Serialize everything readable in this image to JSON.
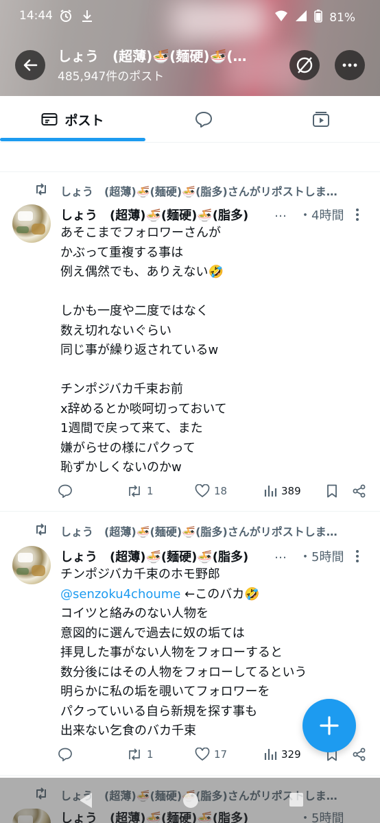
{
  "status_bar": {
    "time": "14:44",
    "battery": "81%"
  },
  "header": {
    "title": "しょう　(超薄)🍜(麺硬)🍜(…",
    "subtitle": "485,947件のポスト"
  },
  "tabs": [
    {
      "label": "ポスト",
      "icon": "posts-icon",
      "active": true
    },
    {
      "label": "",
      "icon": "replies-icon",
      "active": false
    },
    {
      "label": "",
      "icon": "media-icon",
      "active": false
    }
  ],
  "accent_color": "#1d9bf0",
  "posts": [
    {
      "repost_text": "しょう　(超薄)🍜(麺硬)🍜(脂多)さんがリポストしま…",
      "name": "しょう　(超薄)🍜(麺硬)🍜(脂多)",
      "name_ellipsis": "…",
      "time": "・4時間",
      "lines": [
        "あそこまでフォロワーさんが",
        "かぶって重複する事は",
        "例え偶然でも、ありえない🤣",
        "",
        "しかも一度や二度ではなく",
        "数え切れないぐらい",
        "同じ事が繰り返されているw",
        "",
        "チンポジバカ千束お前",
        "x辞めるとか啖呵切っておいて",
        "1週間で戻って来て、また",
        "嫌がらせの様にパクって",
        "恥ずかしくないのかw"
      ],
      "reposts": "1",
      "likes": "18",
      "views": "389"
    },
    {
      "repost_text": "しょう　(超薄)🍜(麺硬)🍜(脂多)さんがリポストしま…",
      "name": "しょう　(超薄)🍜(麺硬)🍜(脂多)",
      "name_ellipsis": "…",
      "time": "・5時間",
      "lines_before": [
        "チンポジバカ千束のホモ野郎"
      ],
      "mention": "@senzoku4choume",
      "mention_suffix": " ←このバカ🤣",
      "lines_after": [
        "コイツと絡みのない人物を",
        "意図的に選んで過去に奴の垢ては",
        "拝見した事がない人物をフォローすると",
        "数分後にはその人物をフォローしてるという",
        "明らかに私の垢を覗いてフォロワーを",
        "パクっていいる自ら新規を探す事も",
        "出来ない乞食のバカ千束"
      ],
      "reposts": "1",
      "likes": "17",
      "views": "329"
    },
    {
      "repost_text": "しょう　(超薄)🍜(麺硬)🍜(脂多)さんがリポストしま…",
      "name": "しょう　(超薄)🍜(麺硬)🍜(脂多)",
      "time": "・5時間"
    }
  ]
}
